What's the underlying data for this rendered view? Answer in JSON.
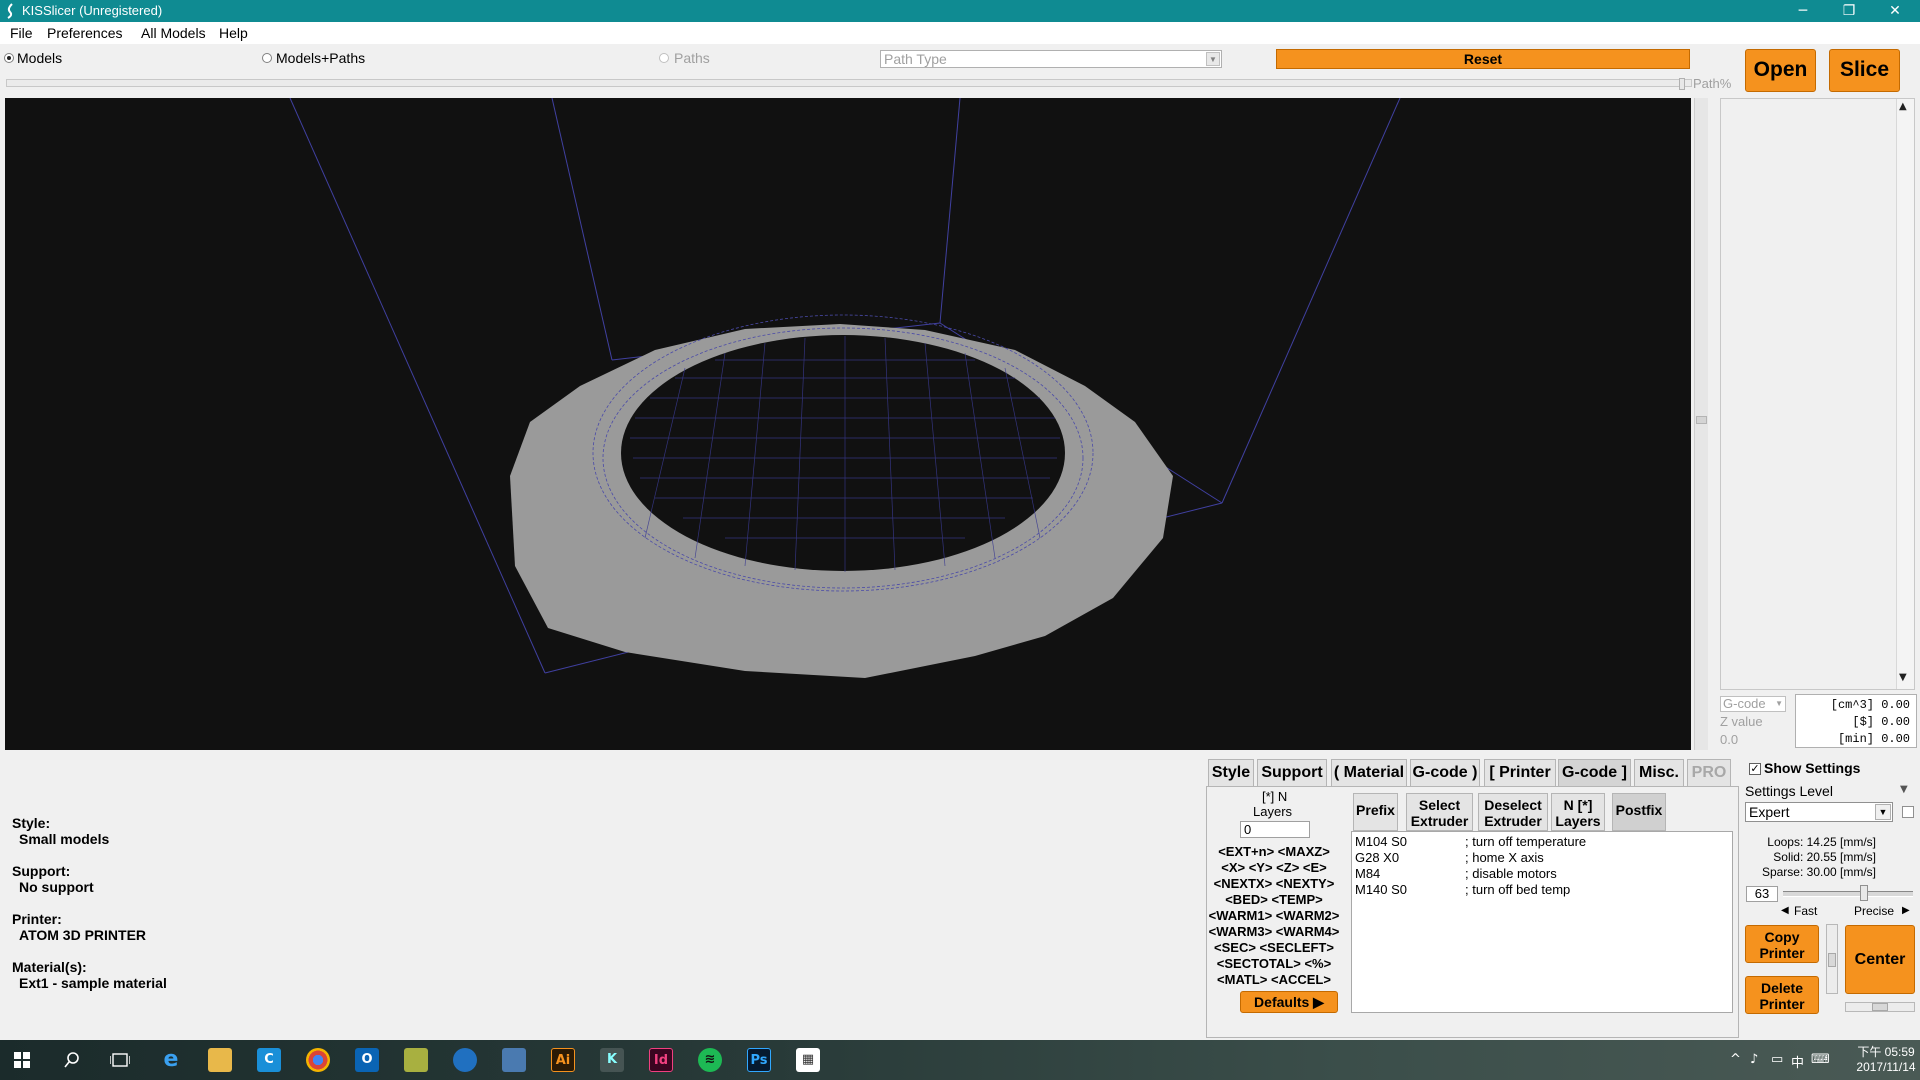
{
  "window": {
    "title": "KISSlicer (Unregistered)",
    "minimize": "─",
    "maximize": "❐",
    "close": "✕"
  },
  "menu": [
    "File",
    "Preferences",
    "All Models",
    "Help"
  ],
  "toolbar": {
    "view_models": "Models",
    "view_models_paths": "Models+Paths",
    "view_paths": "Paths",
    "path_type_placeholder": "Path Type",
    "reset": "Reset",
    "open": "Open",
    "slice": "Slice",
    "path_pct": "Path%"
  },
  "stats": {
    "mode": "G-code",
    "z_label": "Z value",
    "z_value": "0.0",
    "volume": "[cm^3] 0.00",
    "cost": "[$] 0.00",
    "time": "[min] 0.00"
  },
  "info": {
    "style_label": "Style:",
    "style_value": "Small models",
    "support_label": "Support:",
    "support_value": "No support",
    "printer_label": "Printer:",
    "printer_value": "ATOM 3D PRINTER",
    "material_label": "Material(s):",
    "material_value": "Ext1 - sample material"
  },
  "tabs": [
    "Style",
    "Support",
    "( Material",
    "G-code )",
    "[ Printer",
    "G-code ]",
    "Misc.",
    "PRO"
  ],
  "gcode": {
    "n_label": "[*] N",
    "layers_label": "Layers",
    "n_layers_value": "0",
    "macros": [
      "<EXT+n> <MAXZ>",
      "<X> <Y> <Z> <E>",
      "<NEXTX> <NEXTY>",
      "<BED> <TEMP>",
      "<WARM1> <WARM2>",
      "<WARM3> <WARM4>",
      "<SEC> <SECLEFT>",
      "<SECTOTAL> <%>",
      "<MATL> <ACCEL>"
    ],
    "defaults": "Defaults",
    "subtabs": [
      {
        "l1": "Prefix",
        "l2": ""
      },
      {
        "l1": "Select",
        "l2": "Extruder"
      },
      {
        "l1": "Deselect",
        "l2": "Extruder"
      },
      {
        "l1": "N [*]",
        "l2": "Layers"
      },
      {
        "l1": "Postfix",
        "l2": ""
      }
    ],
    "lines": [
      {
        "code": "M104 S0",
        "comment": "; turn off temperature"
      },
      {
        "code": "G28 X0",
        "comment": "; home X axis"
      },
      {
        "code": "M84",
        "comment": "; disable motors"
      },
      {
        "code": "M140 S0",
        "comment": "; turn off bed temp"
      }
    ]
  },
  "settings": {
    "show_settings": "Show Settings",
    "show_settings_checked": true,
    "level_label": "Settings Level",
    "level_value": "Expert",
    "loops": "Loops:  14.25 [mm/s]",
    "solid": "Solid:  20.55 [mm/s]",
    "sparse": "Sparse: 30.00 [mm/s]",
    "quality_value": "63",
    "fast": "Fast",
    "precise": "Precise",
    "copy_printer_1": "Copy",
    "copy_printer_2": "Printer",
    "delete_printer_1": "Delete",
    "delete_printer_2": "Printer",
    "center": "Center"
  },
  "taskbar": {
    "ime": "中",
    "time": "下午 05:59",
    "date": "2017/11/14"
  },
  "colors": {
    "titlebar": "#0f8b92",
    "accent_orange": "#f5921e",
    "viewport_bg": "#111111",
    "model_gray": "#9a9a9a",
    "wireframe": "#4a4a9a"
  }
}
